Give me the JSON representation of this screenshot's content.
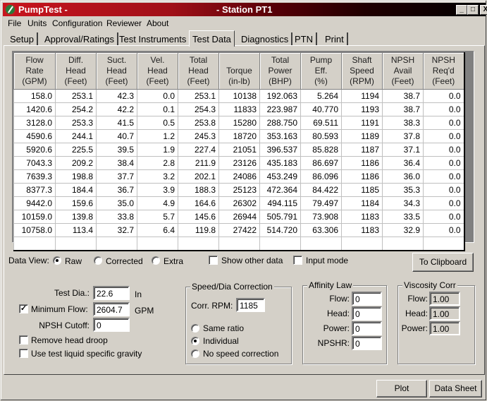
{
  "window": {
    "app_title": "PumpTest -",
    "station_title": "- Station PT1",
    "controls": {
      "minimize": "_",
      "maximize": "□",
      "close": "X"
    }
  },
  "menu": [
    "File",
    "Units",
    "Configuration",
    "Reviewer",
    "About"
  ],
  "tabs": [
    {
      "label": "Setup",
      "active": false
    },
    {
      "label": "Approval/Ratings",
      "active": false
    },
    {
      "label": "Test Instruments",
      "active": false
    },
    {
      "label": "Test Data",
      "active": true
    },
    {
      "label": "Diagnostics",
      "active": false
    },
    {
      "label": "PTN",
      "active": false
    },
    {
      "label": "Print",
      "active": false
    }
  ],
  "grid": {
    "columns": [
      [
        "Flow",
        "Rate",
        "(GPM)"
      ],
      [
        "Diff.",
        "Head",
        "(Feet)"
      ],
      [
        "Suct.",
        "Head",
        "(Feet)"
      ],
      [
        "Vel.",
        "Head",
        "(Feet)"
      ],
      [
        "Total",
        "Head",
        "(Feet)"
      ],
      [
        "",
        "Torque",
        "(in-lb)"
      ],
      [
        "Total",
        "Power",
        "(BHP)"
      ],
      [
        "Pump",
        "Eff.",
        "(%)"
      ],
      [
        "Shaft",
        "Speed",
        "(RPM)"
      ],
      [
        "NPSH",
        "Avail",
        "(Feet)"
      ],
      [
        "NPSH",
        "Req'd",
        "(Feet)"
      ]
    ],
    "rows": [
      [
        "158.0",
        "253.1",
        "42.3",
        "0.0",
        "253.1",
        "10138",
        "192.063",
        "5.264",
        "1194",
        "38.7",
        "0.0"
      ],
      [
        "1420.6",
        "254.2",
        "42.2",
        "0.1",
        "254.3",
        "11833",
        "223.987",
        "40.770",
        "1193",
        "38.7",
        "0.0"
      ],
      [
        "3128.0",
        "253.3",
        "41.5",
        "0.5",
        "253.8",
        "15280",
        "288.750",
        "69.511",
        "1191",
        "38.3",
        "0.0"
      ],
      [
        "4590.6",
        "244.1",
        "40.7",
        "1.2",
        "245.3",
        "18720",
        "353.163",
        "80.593",
        "1189",
        "37.8",
        "0.0"
      ],
      [
        "5920.6",
        "225.5",
        "39.5",
        "1.9",
        "227.4",
        "21051",
        "396.537",
        "85.828",
        "1187",
        "37.1",
        "0.0"
      ],
      [
        "7043.3",
        "209.2",
        "38.4",
        "2.8",
        "211.9",
        "23126",
        "435.183",
        "86.697",
        "1186",
        "36.4",
        "0.0"
      ],
      [
        "7639.3",
        "198.8",
        "37.7",
        "3.2",
        "202.1",
        "24086",
        "453.249",
        "86.096",
        "1186",
        "36.0",
        "0.0"
      ],
      [
        "8377.3",
        "184.4",
        "36.7",
        "3.9",
        "188.3",
        "25123",
        "472.364",
        "84.422",
        "1185",
        "35.3",
        "0.0"
      ],
      [
        "9442.0",
        "159.6",
        "35.0",
        "4.9",
        "164.6",
        "26302",
        "494.115",
        "79.497",
        "1184",
        "34.3",
        "0.0"
      ],
      [
        "10159.0",
        "139.8",
        "33.8",
        "5.7",
        "145.6",
        "26944",
        "505.791",
        "73.908",
        "1183",
        "33.5",
        "0.0"
      ],
      [
        "10758.0",
        "113.4",
        "32.7",
        "6.4",
        "119.8",
        "27422",
        "514.720",
        "63.306",
        "1183",
        "32.9",
        "0.0"
      ],
      [
        "",
        "",
        "",
        "",
        "",
        "",
        "",
        "",
        "",
        "",
        ""
      ]
    ]
  },
  "data_view": {
    "label": "Data View:",
    "options": [
      {
        "label": "Raw",
        "selected": true
      },
      {
        "label": "Corrected",
        "selected": false
      },
      {
        "label": "Extra",
        "selected": false
      }
    ],
    "show_other_data": {
      "label": "Show other data",
      "checked": false
    },
    "input_mode": {
      "label": "Input mode",
      "checked": false
    },
    "clipboard_button": "To Clipboard"
  },
  "settings": {
    "test_dia": {
      "label": "Test Dia.:",
      "value": "22.6",
      "unit": "In"
    },
    "minimum_flow": {
      "label": "Minimum Flow:",
      "value": "2604.7",
      "unit": "GPM",
      "checked": true
    },
    "npsh_cutoff": {
      "label": "NPSH Cutoff:",
      "value": "0"
    },
    "remove_head_droop": {
      "label": "Remove head droop",
      "checked": false
    },
    "use_specific_gravity": {
      "label": "Use test liquid specific gravity",
      "checked": false
    }
  },
  "speed_dia": {
    "title": "Speed/Dia Correction",
    "corr_rpm_label": "Corr. RPM:",
    "corr_rpm_value": "1185",
    "options": [
      {
        "label": "Same ratio",
        "selected": false
      },
      {
        "label": "Individual",
        "selected": true
      },
      {
        "label": "No speed correction",
        "selected": false
      }
    ]
  },
  "affinity_law": {
    "title": "Affinity Law",
    "fields": [
      {
        "label": "Flow:",
        "value": "0"
      },
      {
        "label": "Head:",
        "value": "0"
      },
      {
        "label": "Power:",
        "value": "0"
      },
      {
        "label": "NPSHR:",
        "value": "0"
      }
    ]
  },
  "viscosity_corr": {
    "title": "Viscosity Corr",
    "fields": [
      {
        "label": "Flow:",
        "value": "1.00"
      },
      {
        "label": "Head:",
        "value": "1.00"
      },
      {
        "label": "Power:",
        "value": "1.00"
      }
    ]
  },
  "footer": {
    "plot_button": "Plot",
    "data_sheet_button": "Data Sheet"
  }
}
